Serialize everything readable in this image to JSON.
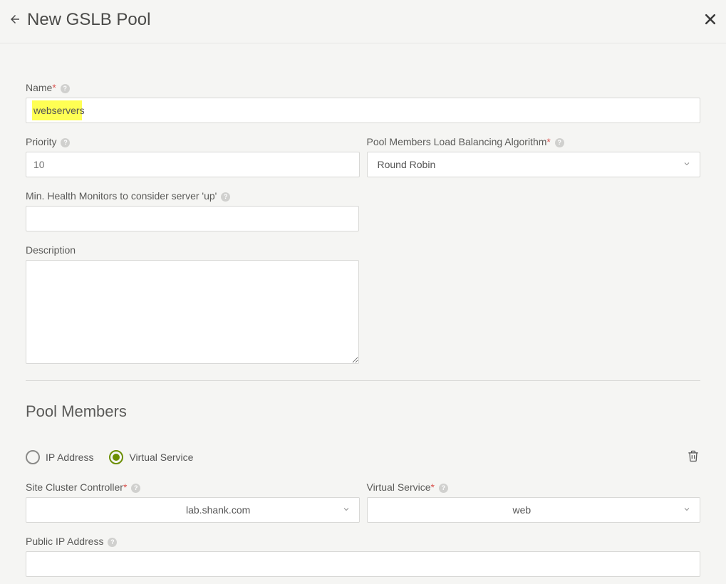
{
  "header": {
    "title": "New GSLB Pool"
  },
  "form": {
    "name": {
      "label": "Name",
      "value": "webservers"
    },
    "priority": {
      "label": "Priority",
      "placeholder": "10",
      "value": ""
    },
    "algorithm": {
      "label": "Pool Members Load Balancing Algorithm",
      "value": "Round Robin"
    },
    "min_health": {
      "label": "Min. Health Monitors to consider server 'up'",
      "value": ""
    },
    "description": {
      "label": "Description",
      "value": ""
    }
  },
  "pool_members": {
    "section_title": "Pool Members",
    "radio": {
      "ip_label": "IP Address",
      "vs_label": "Virtual Service",
      "selected": "vs"
    },
    "site_controller": {
      "label": "Site Cluster Controller",
      "value": "lab.shank.com"
    },
    "virtual_service": {
      "label": "Virtual Service",
      "value": "web"
    },
    "public_ip": {
      "label": "Public IP Address",
      "value": ""
    }
  }
}
